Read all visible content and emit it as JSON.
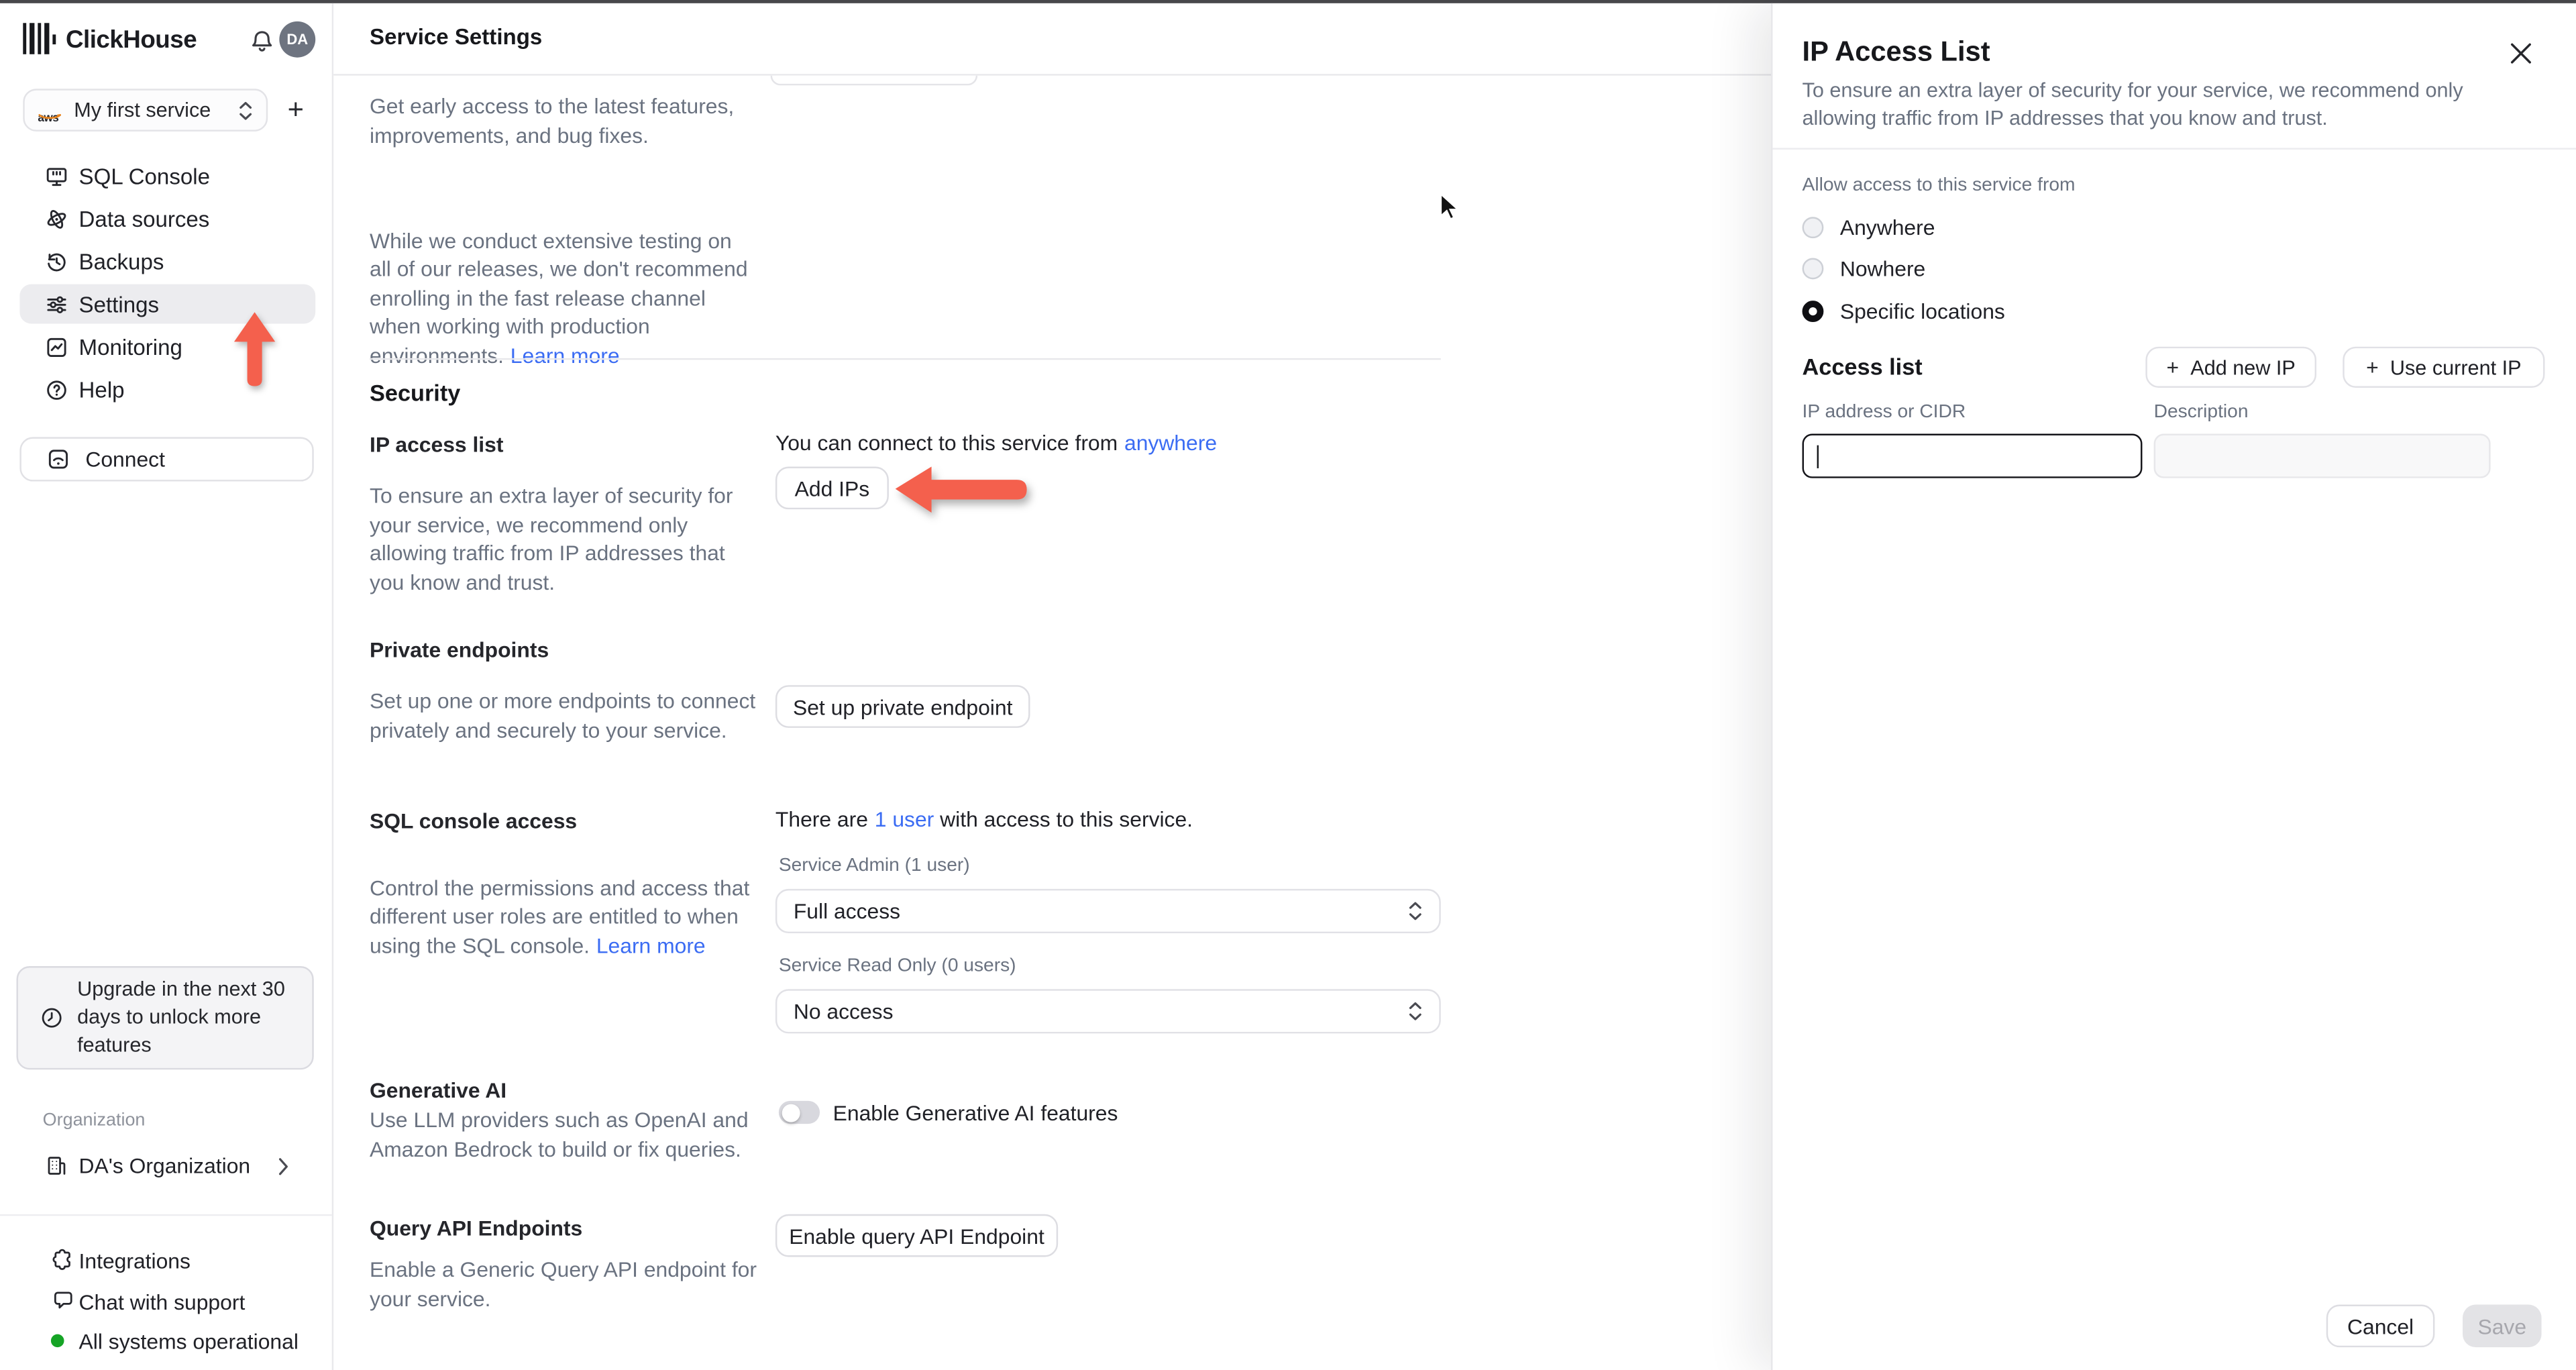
{
  "sidebar": {
    "brand": "ClickHouse",
    "avatar_initials": "DA",
    "service_selector": {
      "provider": "aws",
      "label": "My first service"
    },
    "add_service_label": "+",
    "nav": [
      {
        "label": "SQL Console",
        "active": false
      },
      {
        "label": "Data sources",
        "active": false
      },
      {
        "label": "Backups",
        "active": false
      },
      {
        "label": "Settings",
        "active": true
      },
      {
        "label": "Monitoring",
        "active": false
      },
      {
        "label": "Help",
        "active": false
      }
    ],
    "connect_label": "Connect",
    "upgrade_notice": "Upgrade in the next 30\ndays to unlock more\nfeatures",
    "organization_section_label": "Organization",
    "organization_name": "DA's Organization",
    "footer_items": [
      "Integrations",
      "Chat with support",
      "All systems operational"
    ]
  },
  "main": {
    "header_title": "Service Settings",
    "release_channel": {
      "paragraph1": "Get early access to the latest features,\nimprovements, and bug fixes.",
      "paragraph2": "While we conduct extensive testing on\nall of our releases, we don't recommend\nenrolling in the fast release channel\nwhen working with production\nenvironments.",
      "learn_more_label": "Learn more"
    },
    "security": {
      "section_title": "Security",
      "ip_access_list": {
        "title": "IP access list",
        "description": "To ensure an extra layer of security for\nyour service, we recommend only\nallowing traffic from IP addresses that\nyou know and trust.",
        "connect_text": "You can connect to this service from",
        "connect_link": "anywhere",
        "add_ips_label": "Add IPs"
      },
      "private_endpoints": {
        "title": "Private endpoints",
        "description": "Set up one or more endpoints to connect\nprivately and securely to your service.",
        "button_label": "Set up private endpoint"
      },
      "sql_console_access": {
        "title": "SQL console access",
        "summary_prefix": "There are",
        "summary_link": "1 user",
        "summary_suffix": "with access to this service.",
        "description": "Control the permissions and access that\ndifferent user roles are entitled to when\nusing the SQL console.",
        "learn_more_label": "Learn more",
        "service_admin_label": "Service Admin (1 user)",
        "service_admin_value": "Full access",
        "service_read_only_label": "Service Read Only (0 users)",
        "service_read_only_value": "No access"
      },
      "generative_ai": {
        "title": "Generative AI",
        "toggle_label": "Enable Generative AI features",
        "toggle_on": false,
        "description": "Use LLM providers such as OpenAI and\nAmazon Bedrock to build or fix queries."
      },
      "query_api_endpoints": {
        "title": "Query API Endpoints",
        "button_label": "Enable query API Endpoint",
        "description": "Enable a Generic Query API endpoint for\nyour service."
      }
    }
  },
  "panel": {
    "title": "IP Access List",
    "description": "To ensure an extra layer of security for your service, we recommend only\nallowing traffic from IP addresses that you know and trust.",
    "allow_access_label": "Allow access to this service from",
    "radio_options": [
      {
        "label": "Anywhere",
        "selected": false
      },
      {
        "label": "Nowhere",
        "selected": false
      },
      {
        "label": "Specific locations",
        "selected": true
      }
    ],
    "access_list": {
      "title": "Access list",
      "add_new_ip_label": "Add new IP",
      "use_current_ip_label": "Use current IP",
      "plus_glyph": "+",
      "ip_column_label": "IP address or CIDR",
      "description_column_label": "Description",
      "ip_input_value": "",
      "description_input_value": ""
    },
    "cancel_label": "Cancel",
    "save_label": "Save"
  },
  "colors": {
    "accent_red": "#f4604d",
    "link_blue": "#3b6cf3",
    "status_green": "#16a426"
  }
}
